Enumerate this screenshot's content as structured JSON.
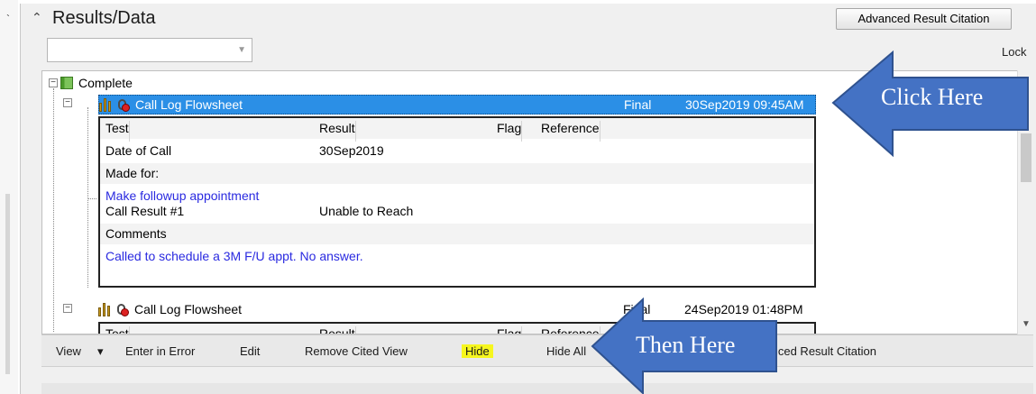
{
  "panel": {
    "title": "Results/Data",
    "collapse_glyph": "⌃",
    "advanced_button": "Advanced Result Citation",
    "lock_label": "Lock"
  },
  "tree": {
    "root_label": "Complete",
    "entries": [
      {
        "name": "Call Log Flowsheet",
        "status": "Final",
        "datetime": "30Sep2019 09:45AM",
        "selected": true,
        "columns": [
          "Test",
          "Result",
          "Flag",
          "Reference"
        ],
        "rows": [
          {
            "test": "Date of Call",
            "result": "30Sep2019"
          },
          {
            "test": "Made for:",
            "result": ""
          },
          {
            "test": "Make followup appointment",
            "result": "",
            "link": true
          },
          {
            "test": "Call Result #1",
            "result": "Unable to Reach"
          },
          {
            "test": "Comments",
            "result": ""
          },
          {
            "test": "Called to schedule a 3M F/U appt. No answer.",
            "result": "",
            "link": true
          }
        ]
      },
      {
        "name": "Call Log Flowsheet",
        "status": "Final",
        "datetime": "24Sep2019 01:48PM",
        "selected": false,
        "columns": [
          "Test",
          "Result",
          "Flag",
          "Reference"
        ]
      }
    ]
  },
  "toolbar": {
    "view": "View",
    "view_caret": "▾",
    "enter_in_error": "Enter in Error",
    "edit": "Edit",
    "remove_cited_view": "Remove Cited View",
    "hide": "Hide",
    "hide_all": "Hide All",
    "advanced_result_citation": "Advanced Result Citation"
  },
  "annotations": {
    "click_here": "Click Here",
    "then_here": "Then  Here",
    "arrow_color": "#4472c4",
    "highlight_color": "#f6f61e",
    "selection_color": "#2b8fe6"
  }
}
